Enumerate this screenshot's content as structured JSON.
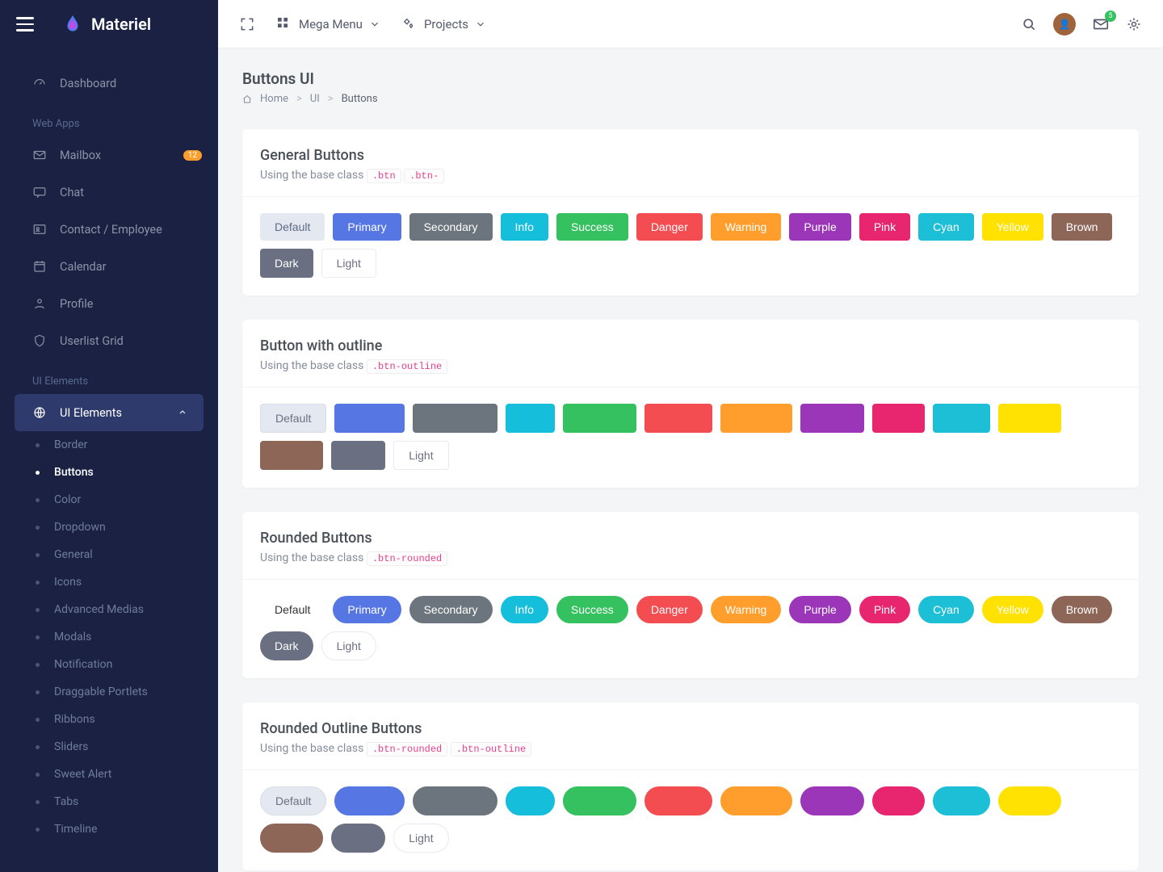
{
  "brand": "Materiel",
  "topbar": {
    "mega_menu": "Mega Menu",
    "projects": "Projects",
    "mail_badge": "5"
  },
  "page": {
    "title": "Buttons UI",
    "breadcrumb": {
      "home": "Home",
      "ui": "UI",
      "buttons": "Buttons"
    }
  },
  "sidebar": {
    "dashboard": "Dashboard",
    "section_webapps": "Web Apps",
    "mailbox": "Mailbox",
    "mailbox_badge": "12",
    "chat": "Chat",
    "contact": "Contact / Employee",
    "calendar": "Calendar",
    "profile": "Profile",
    "userlist": "Userlist Grid",
    "section_ui": "UI Elements",
    "ui_elements": "UI Elements",
    "sub": {
      "border": "Border",
      "buttons": "Buttons",
      "color": "Color",
      "dropdown": "Dropdown",
      "general": "General",
      "icons": "Icons",
      "adv_media": "Advanced Medias",
      "modals": "Modals",
      "notification": "Notification",
      "draggable": "Draggable Portlets",
      "ribbons": "Ribbons",
      "sliders": "Sliders",
      "sweet_alert": "Sweet Alert",
      "tabs": "Tabs",
      "timeline": "Timeline"
    }
  },
  "cards": {
    "general": {
      "title": "General Buttons",
      "sub": "Using the base class",
      "codes": [
        ".btn",
        ".btn-"
      ]
    },
    "outline": {
      "title": "Button with outline",
      "sub": "Using the base class",
      "codes": [
        ".btn-outline"
      ]
    },
    "rounded": {
      "title": "Rounded Buttons",
      "sub": "Using the base class",
      "codes": [
        ".btn-rounded"
      ]
    },
    "rounded_outline": {
      "title": "Rounded Outline Buttons",
      "sub": "Using the base class",
      "codes": [
        ".btn-rounded",
        ".btn-outline"
      ]
    }
  },
  "buttons": {
    "default": "Default",
    "primary": "Primary",
    "secondary": "Secondary",
    "info": "Info",
    "success": "Success",
    "danger": "Danger",
    "warning": "Warning",
    "purple": "Purple",
    "pink": "Pink",
    "cyan": "Cyan",
    "yellow": "Yellow",
    "brown": "Brown",
    "dark": "Dark",
    "light": "Light"
  }
}
